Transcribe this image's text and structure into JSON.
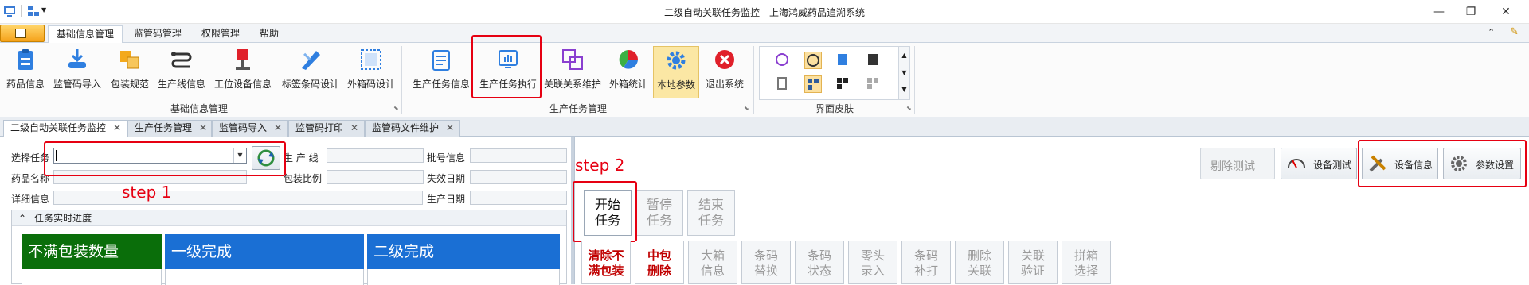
{
  "window": {
    "title": "二级自动关联任务监控 - 上海鸿威药品追溯系统"
  },
  "ribbon_tabs": [
    "基础信息管理",
    "监管码管理",
    "权限管理",
    "帮助"
  ],
  "ribbon": {
    "basic": [
      {
        "label": "药品信息",
        "icon": "clipboard-icon"
      },
      {
        "label": "监管码导入",
        "icon": "import-icon"
      },
      {
        "label": "包装规范",
        "icon": "package-icon"
      },
      {
        "label": "生产线信息",
        "icon": "production-line-icon"
      },
      {
        "label": "工位设备信息",
        "icon": "station-device-icon"
      },
      {
        "label": "标签条码设计",
        "icon": "label-design-icon"
      },
      {
        "label": "外箱码设计",
        "icon": "outer-box-design-icon"
      }
    ],
    "basic_group": "基础信息管理",
    "task": [
      {
        "label": "生产任务信息",
        "icon": "task-info-icon"
      },
      {
        "label": "生产任务执行",
        "icon": "task-execute-icon"
      },
      {
        "label": "关联关系维护",
        "icon": "relation-icon"
      },
      {
        "label": "外箱统计",
        "icon": "pie-chart-icon"
      },
      {
        "label": "本地参数",
        "icon": "gear-icon"
      },
      {
        "label": "退出系统",
        "icon": "exit-icon"
      }
    ],
    "task_group": "生产任务管理",
    "skin_group": "界面皮肤"
  },
  "doc_tabs": [
    "二级自动关联任务监控",
    "生产任务管理",
    "监管码导入",
    "监管码打印",
    "监管码文件维护"
  ],
  "form": {
    "select_task": "选择任务",
    "drug_name": "药品名称",
    "detail_info": "详细信息",
    "production_line": "生 产 线",
    "pack_ratio": "包装比例",
    "batch_info": "批号信息",
    "expiry_date": "失效日期",
    "production_date": "生产日期"
  },
  "progress": {
    "title": "任务实时进度",
    "boxes": [
      "不满包装数量",
      "一级完成",
      "二级完成"
    ]
  },
  "annotations": {
    "step1": "step 1",
    "step2": "step 2"
  },
  "toolbar": {
    "remove_test": "剔除测试",
    "device_test": "设备测试",
    "device_info": "设备信息",
    "param_settings": "参数设置"
  },
  "task_buttons": {
    "start": [
      "开始",
      "任务"
    ],
    "pause": [
      "暂停",
      "任务"
    ],
    "end": [
      "结束",
      "任务"
    ]
  },
  "ops": [
    [
      "清除不",
      "满包装"
    ],
    [
      "中包",
      "删除"
    ],
    [
      "大箱",
      "信息"
    ],
    [
      "条码",
      "替换"
    ],
    [
      "条码",
      "状态"
    ],
    [
      "零头",
      "录入"
    ],
    [
      "条码",
      "补打"
    ],
    [
      "删除",
      "关联"
    ],
    [
      "关联",
      "验证"
    ],
    [
      "拼箱",
      "选择"
    ]
  ],
  "colors": {
    "green": "#0a6e0a",
    "blue": "#1a6fd4",
    "red": "#e60012",
    "accent": "#f5a21a"
  }
}
